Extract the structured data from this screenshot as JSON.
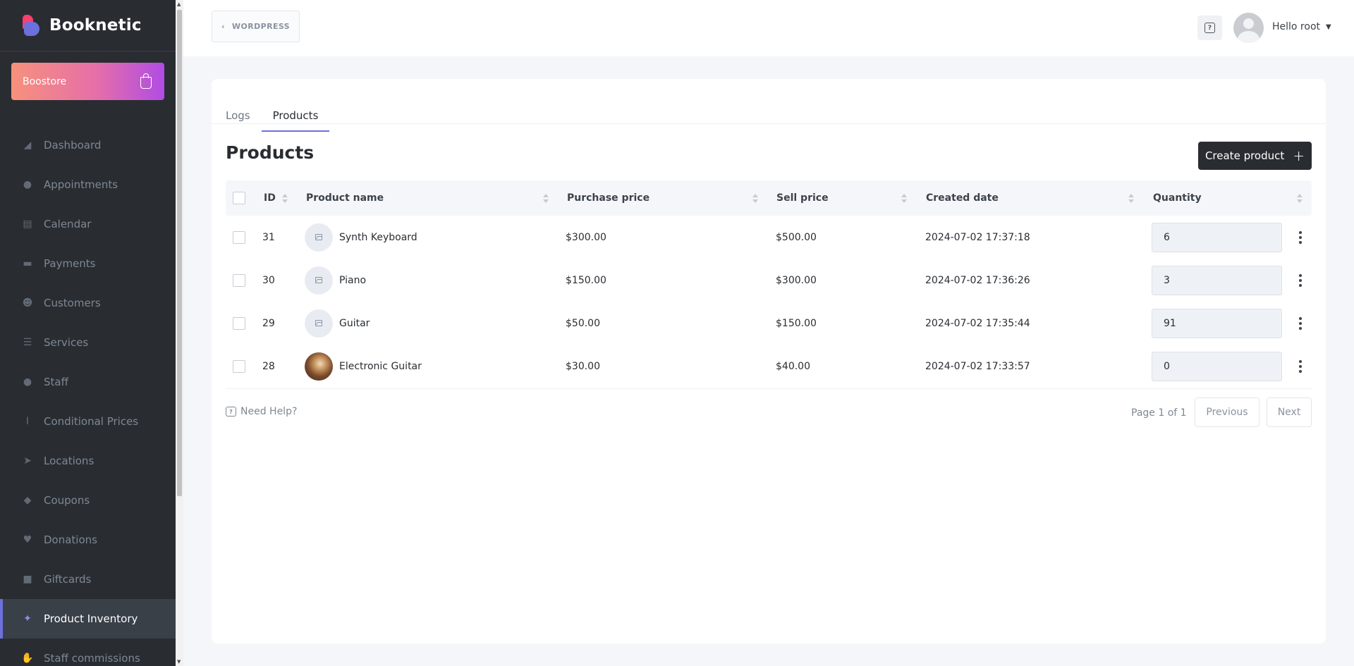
{
  "sidebar": {
    "brand": "Booknetic",
    "boostore": "Boostore",
    "items": [
      {
        "label": "Dashboard",
        "icon": "cube-icon"
      },
      {
        "label": "Appointments",
        "icon": "clock-icon"
      },
      {
        "label": "Calendar",
        "icon": "calendar-icon"
      },
      {
        "label": "Payments",
        "icon": "credit-card-icon"
      },
      {
        "label": "Customers",
        "icon": "users-icon"
      },
      {
        "label": "Services",
        "icon": "list-icon"
      },
      {
        "label": "Staff",
        "icon": "user-icon"
      },
      {
        "label": "Conditional Prices",
        "icon": "i-cursor-icon"
      },
      {
        "label": "Locations",
        "icon": "location-arrow-icon"
      },
      {
        "label": "Coupons",
        "icon": "tag-icon"
      },
      {
        "label": "Donations",
        "icon": "hand-holding-icon"
      },
      {
        "label": "Giftcards",
        "icon": "gift-icon"
      },
      {
        "label": "Product Inventory",
        "icon": "magic-wand-icon"
      },
      {
        "label": "Staff commissions",
        "icon": "handshake-icon"
      }
    ]
  },
  "header": {
    "wordpress": "WORDPRESS",
    "user_greeting": "Hello root"
  },
  "tabs": [
    {
      "label": "Logs"
    },
    {
      "label": "Products"
    }
  ],
  "page_title": "Products",
  "create_button": "Create product",
  "table": {
    "columns": [
      "ID",
      "Product name",
      "Purchase price",
      "Sell price",
      "Created date",
      "Quantity"
    ],
    "rows": [
      {
        "id": "31",
        "name": "Synth Keyboard",
        "purchase": "$300.00",
        "sell": "$500.00",
        "created": "2024-07-02 17:37:18",
        "qty": "6"
      },
      {
        "id": "30",
        "name": "Piano",
        "purchase": "$150.00",
        "sell": "$300.00",
        "created": "2024-07-02 17:36:26",
        "qty": "3"
      },
      {
        "id": "29",
        "name": "Guitar",
        "purchase": "$50.00",
        "sell": "$150.00",
        "created": "2024-07-02 17:35:44",
        "qty": "91"
      },
      {
        "id": "28",
        "name": "Electronic Guitar",
        "purchase": "$30.00",
        "sell": "$40.00",
        "created": "2024-07-02 17:33:57",
        "qty": "0"
      }
    ]
  },
  "footer": {
    "need_help": "Need Help?",
    "page_info": "Page 1 of 1",
    "previous": "Previous",
    "next": "Next"
  },
  "colors": {
    "sidebar_bg": "#292d32",
    "accent": "#6c70dc",
    "boostore_gradient": [
      "#f7917c",
      "#e66fa8",
      "#b04ce4"
    ]
  }
}
